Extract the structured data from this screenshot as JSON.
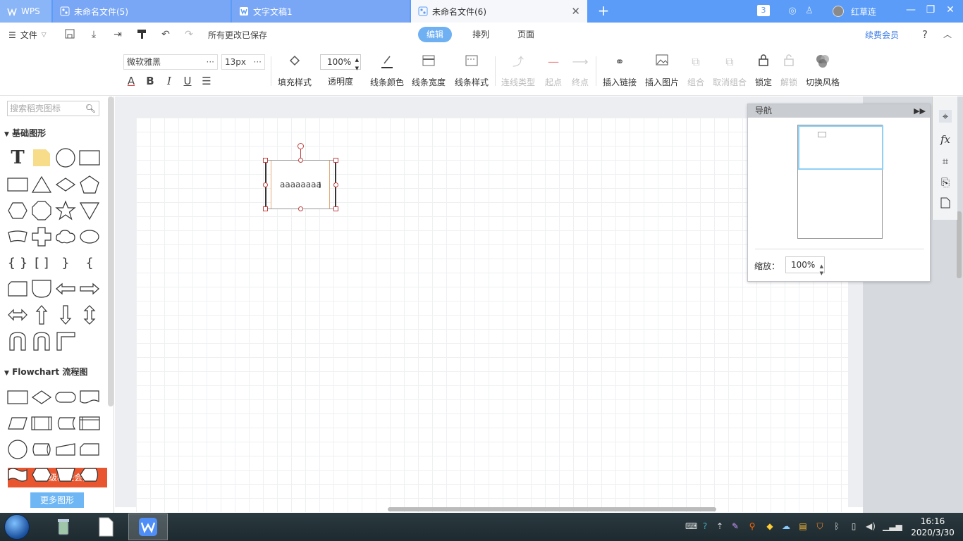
{
  "titlebar": {
    "tabs": [
      {
        "label": "WPS"
      },
      {
        "label": "未命名文件(5)"
      },
      {
        "label": "文字文稿1"
      },
      {
        "label": "未命名文件(6)"
      }
    ],
    "window_count": "3",
    "username": "红草连"
  },
  "menubar": {
    "file_label": "文件",
    "saved_status": "所有更改已保存",
    "tabs": [
      "编辑",
      "排列",
      "页面"
    ],
    "vip_label": "续费会员",
    "help": "?"
  },
  "toolbar": {
    "font_name": "微软雅黑",
    "font_size": "13px",
    "opacity_value": "100%",
    "tools": {
      "fill_style": "填充样式",
      "opacity": "透明度",
      "line_color": "线条颜色",
      "line_width": "线条宽度",
      "line_style": "线条样式",
      "connector_type": "连线类型",
      "start_point": "起点",
      "end_point": "终点",
      "insert_link": "插入链接",
      "insert_image": "插入图片",
      "group": "组合",
      "ungroup": "取消组合",
      "lock": "锁定",
      "unlock": "解锁",
      "switch_style": "切换风格"
    }
  },
  "leftpanel": {
    "search_placeholder": "搜索稻壳图标",
    "section_basic": "基础图形",
    "section_flowchart": "Flowchart 流程图",
    "upgrade_banner": "升级稻壳会员",
    "more_shapes": "更多图形"
  },
  "canvas": {
    "shape_text": "aaaaaaaa"
  },
  "nav_panel": {
    "title": "导航",
    "zoom_label": "缩放：",
    "zoom_value": "100%"
  },
  "taskbar": {
    "time": "16:16",
    "date": "2020/3/30"
  },
  "colors": {
    "titlebar": "#5a9cf8",
    "accent": "#6fb0f3",
    "banner": "#e9552e"
  }
}
